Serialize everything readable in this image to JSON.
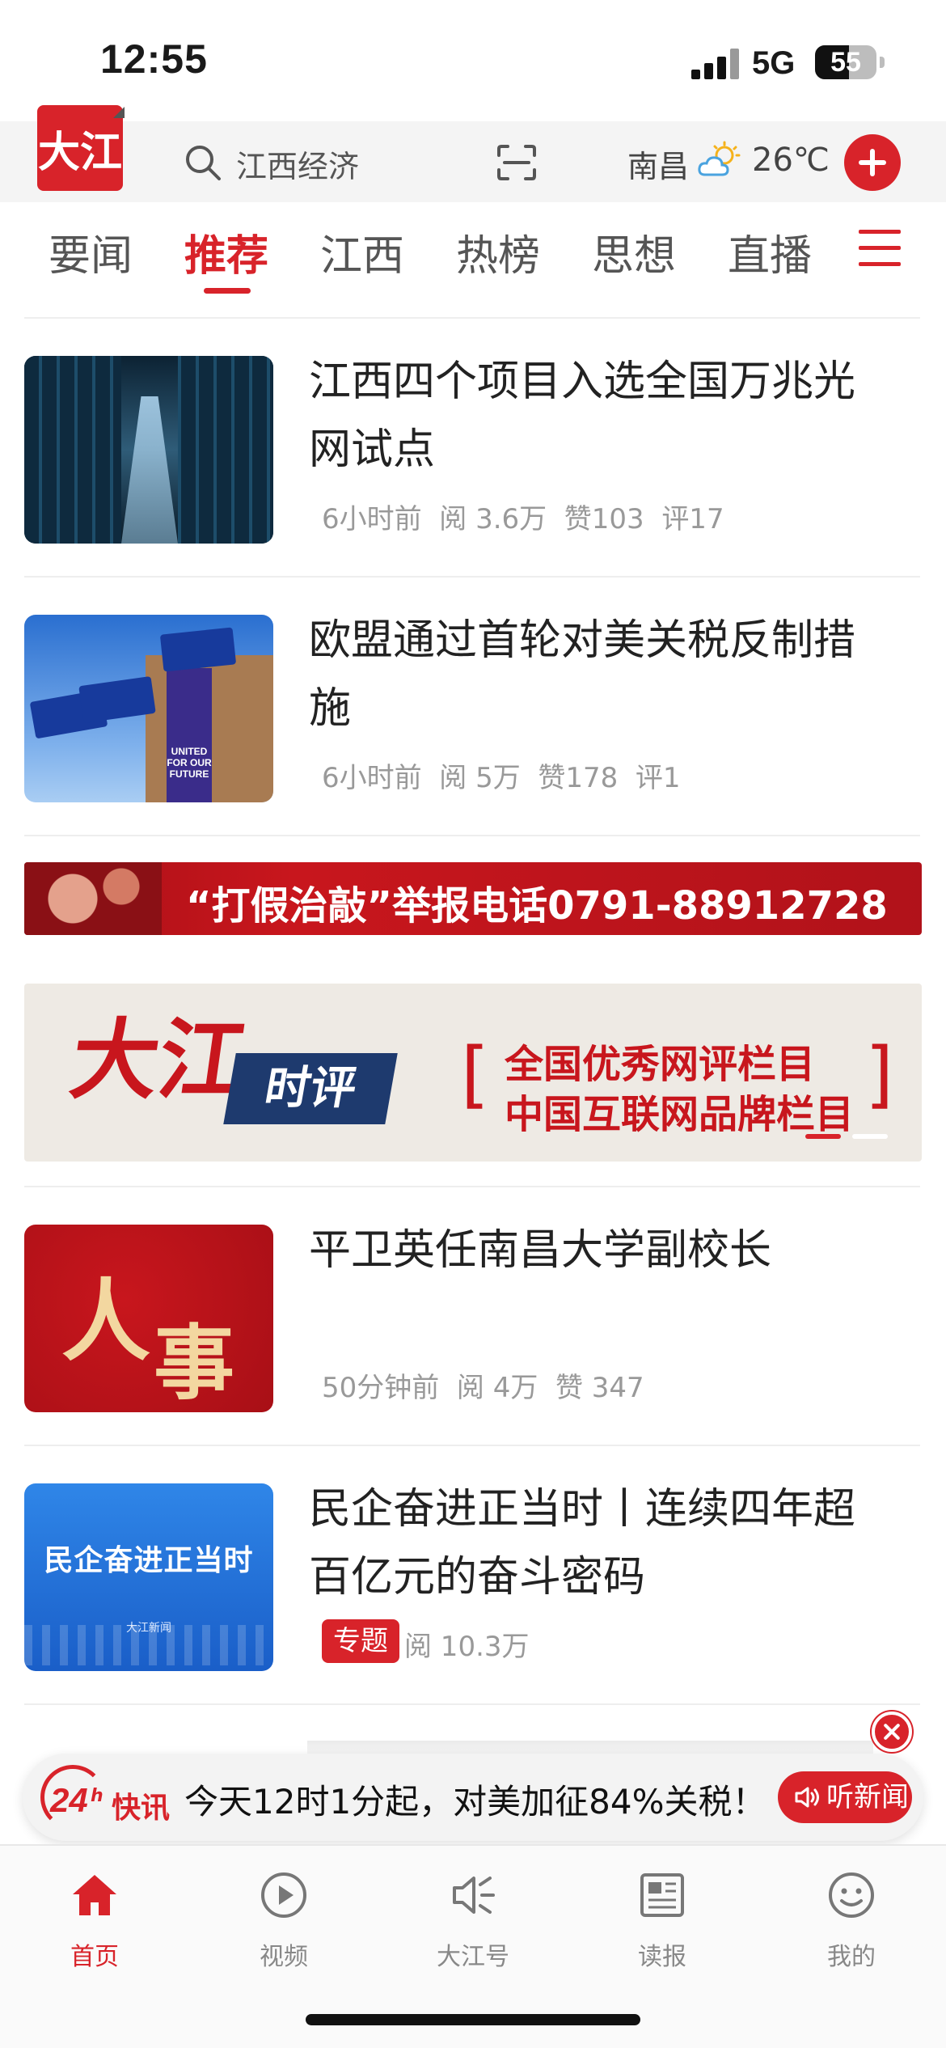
{
  "status_bar": {
    "time": "12:55",
    "network": "5G",
    "battery": "55",
    "battery_level": 0.55
  },
  "header": {
    "logo_text": "大江",
    "search_placeholder": "江西经济",
    "city": "南昌",
    "temperature": "26℃",
    "weather_icon": "partly-cloudy-icon",
    "accent_color": "#d8232a"
  },
  "tabs": [
    {
      "label": "要闻",
      "active": false
    },
    {
      "label": "推荐",
      "active": true
    },
    {
      "label": "江西",
      "active": false
    },
    {
      "label": "热榜",
      "active": false
    },
    {
      "label": "思想",
      "active": false
    },
    {
      "label": "直播",
      "active": false
    }
  ],
  "news": [
    {
      "title": "江西四个项目入选全国万兆光网试点",
      "time": "6小时前",
      "reads": "阅 3.6万",
      "likes": "赞103",
      "comments": "评17"
    },
    {
      "title": "欧盟通过首轮对美关税反制措施",
      "time": "6小时前",
      "reads": "阅 5万",
      "likes": "赞178",
      "comments": "评1",
      "thumb_text": "UNITED FOR OUR FUTURE"
    },
    {
      "title": "平卫英任南昌大学副校长",
      "time": "50分钟前",
      "reads": "阅 4万",
      "likes": "赞 347",
      "thumb_chars": [
        "人",
        "事"
      ]
    },
    {
      "title": "民企奋进正当时丨连续四年超百亿元的奋斗密码",
      "tag": "专题",
      "reads": "阅 10.3万",
      "thumb_text": "民企奋进正当时",
      "thumb_sub": "大江新闻"
    }
  ],
  "banners": {
    "hotline": "“打假治敲”举报电话0791-88912728",
    "dajiang_logo": "大江",
    "dajiang_badge": "时评",
    "dajiang_line1": "全国优秀网评栏目",
    "dajiang_line2": "中国互联网品牌栏目"
  },
  "ticker": {
    "badge_num": "24",
    "badge_h": "h",
    "badge_label": "快讯",
    "text": "今天12时1分起，对美加征84%关税！",
    "listen_label": "听新闻"
  },
  "tabbar": [
    {
      "label": "首页",
      "icon": "home-icon",
      "active": true
    },
    {
      "label": "视频",
      "icon": "play-icon",
      "active": false
    },
    {
      "label": "大江号",
      "icon": "speaker-icon",
      "active": false
    },
    {
      "label": "读报",
      "icon": "newspaper-icon",
      "active": false
    },
    {
      "label": "我的",
      "icon": "smiley-icon",
      "active": false
    }
  ]
}
